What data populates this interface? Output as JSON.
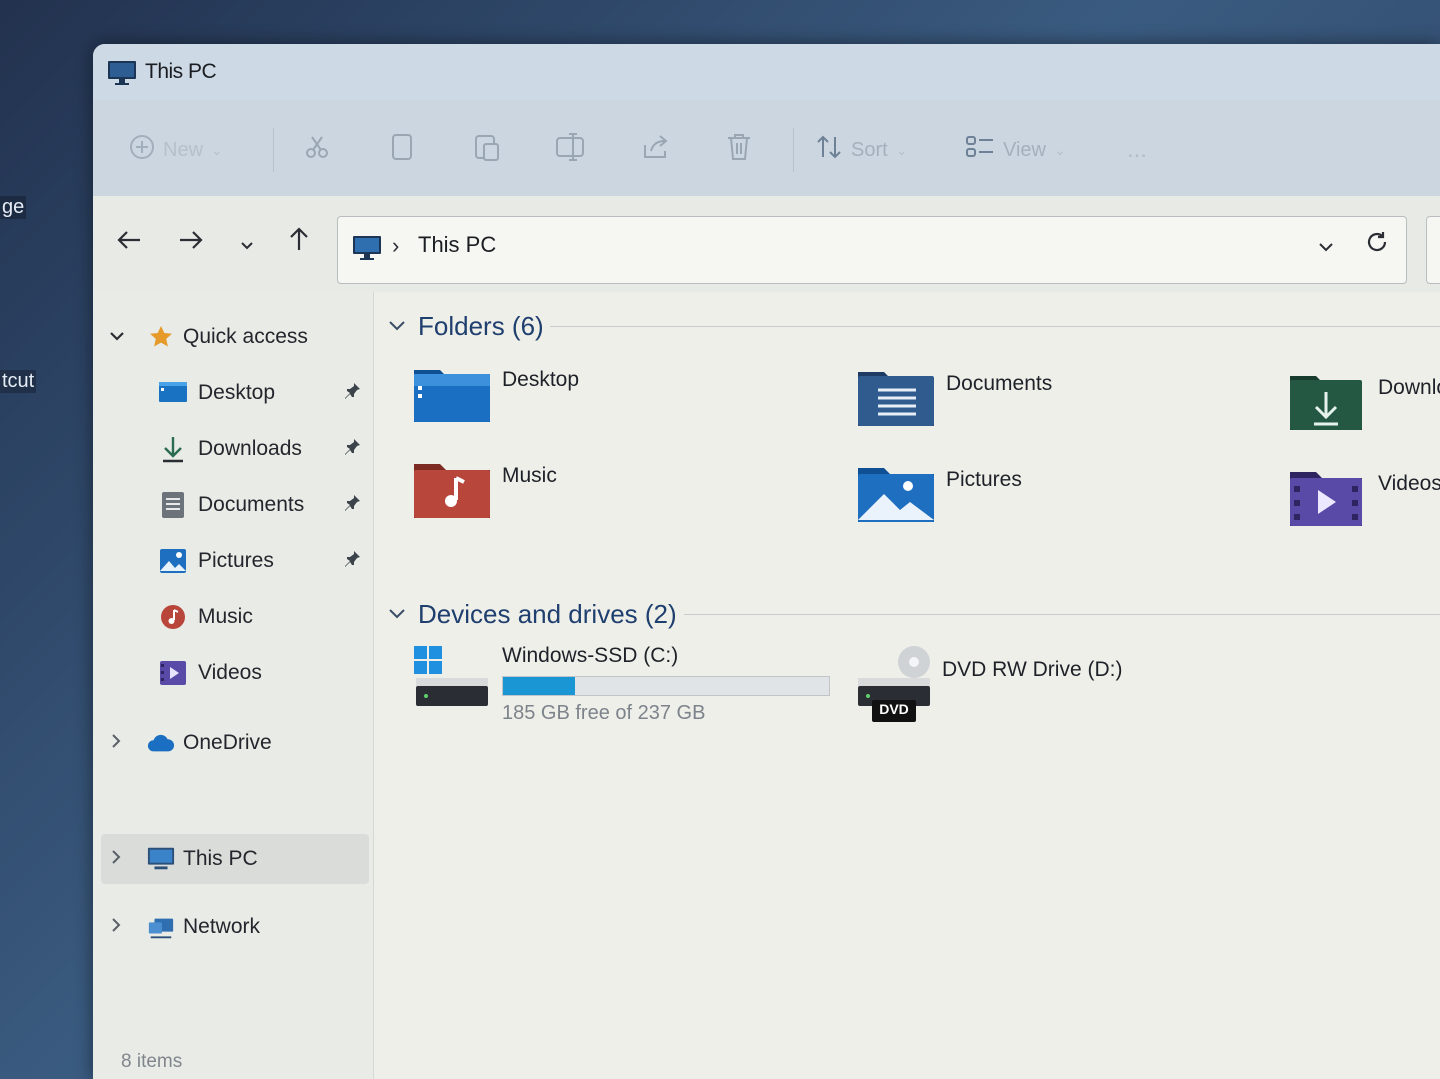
{
  "desktop": {
    "label_top": "ge",
    "label_mid": "tcut"
  },
  "window": {
    "title": "This PC"
  },
  "toolbar": {
    "new_label": "New",
    "sort_label": "Sort",
    "view_label": "View",
    "more_label": "..."
  },
  "address": {
    "crumb": "This PC"
  },
  "sidebar": {
    "quick_access": "Quick access",
    "items": [
      {
        "label": "Desktop",
        "icon": "desktop-icon",
        "pinned": true
      },
      {
        "label": "Downloads",
        "icon": "downloads-icon",
        "pinned": true
      },
      {
        "label": "Documents",
        "icon": "documents-icon",
        "pinned": true
      },
      {
        "label": "Pictures",
        "icon": "pictures-icon",
        "pinned": true
      },
      {
        "label": "Music",
        "icon": "music-icon",
        "pinned": false
      },
      {
        "label": "Videos",
        "icon": "videos-icon",
        "pinned": false
      }
    ],
    "onedrive": "OneDrive",
    "this_pc": "This PC",
    "network": "Network"
  },
  "groups": {
    "folders_header": "Folders (6)",
    "drives_header": "Devices and drives (2)"
  },
  "folders": [
    {
      "label": "Desktop"
    },
    {
      "label": "Documents"
    },
    {
      "label": "Downlo"
    },
    {
      "label": "Music"
    },
    {
      "label": "Pictures"
    },
    {
      "label": "Videos"
    }
  ],
  "drives": [
    {
      "label": "Windows-SSD (C:)",
      "free_text": "185 GB free of 237 GB",
      "used_fraction": 0.22
    },
    {
      "label": "DVD RW Drive (D:)",
      "badge": "DVD"
    }
  ],
  "status": {
    "items": "8 items"
  },
  "colors": {
    "accent": "#1a96d4",
    "header_text": "#1f3f6e"
  }
}
